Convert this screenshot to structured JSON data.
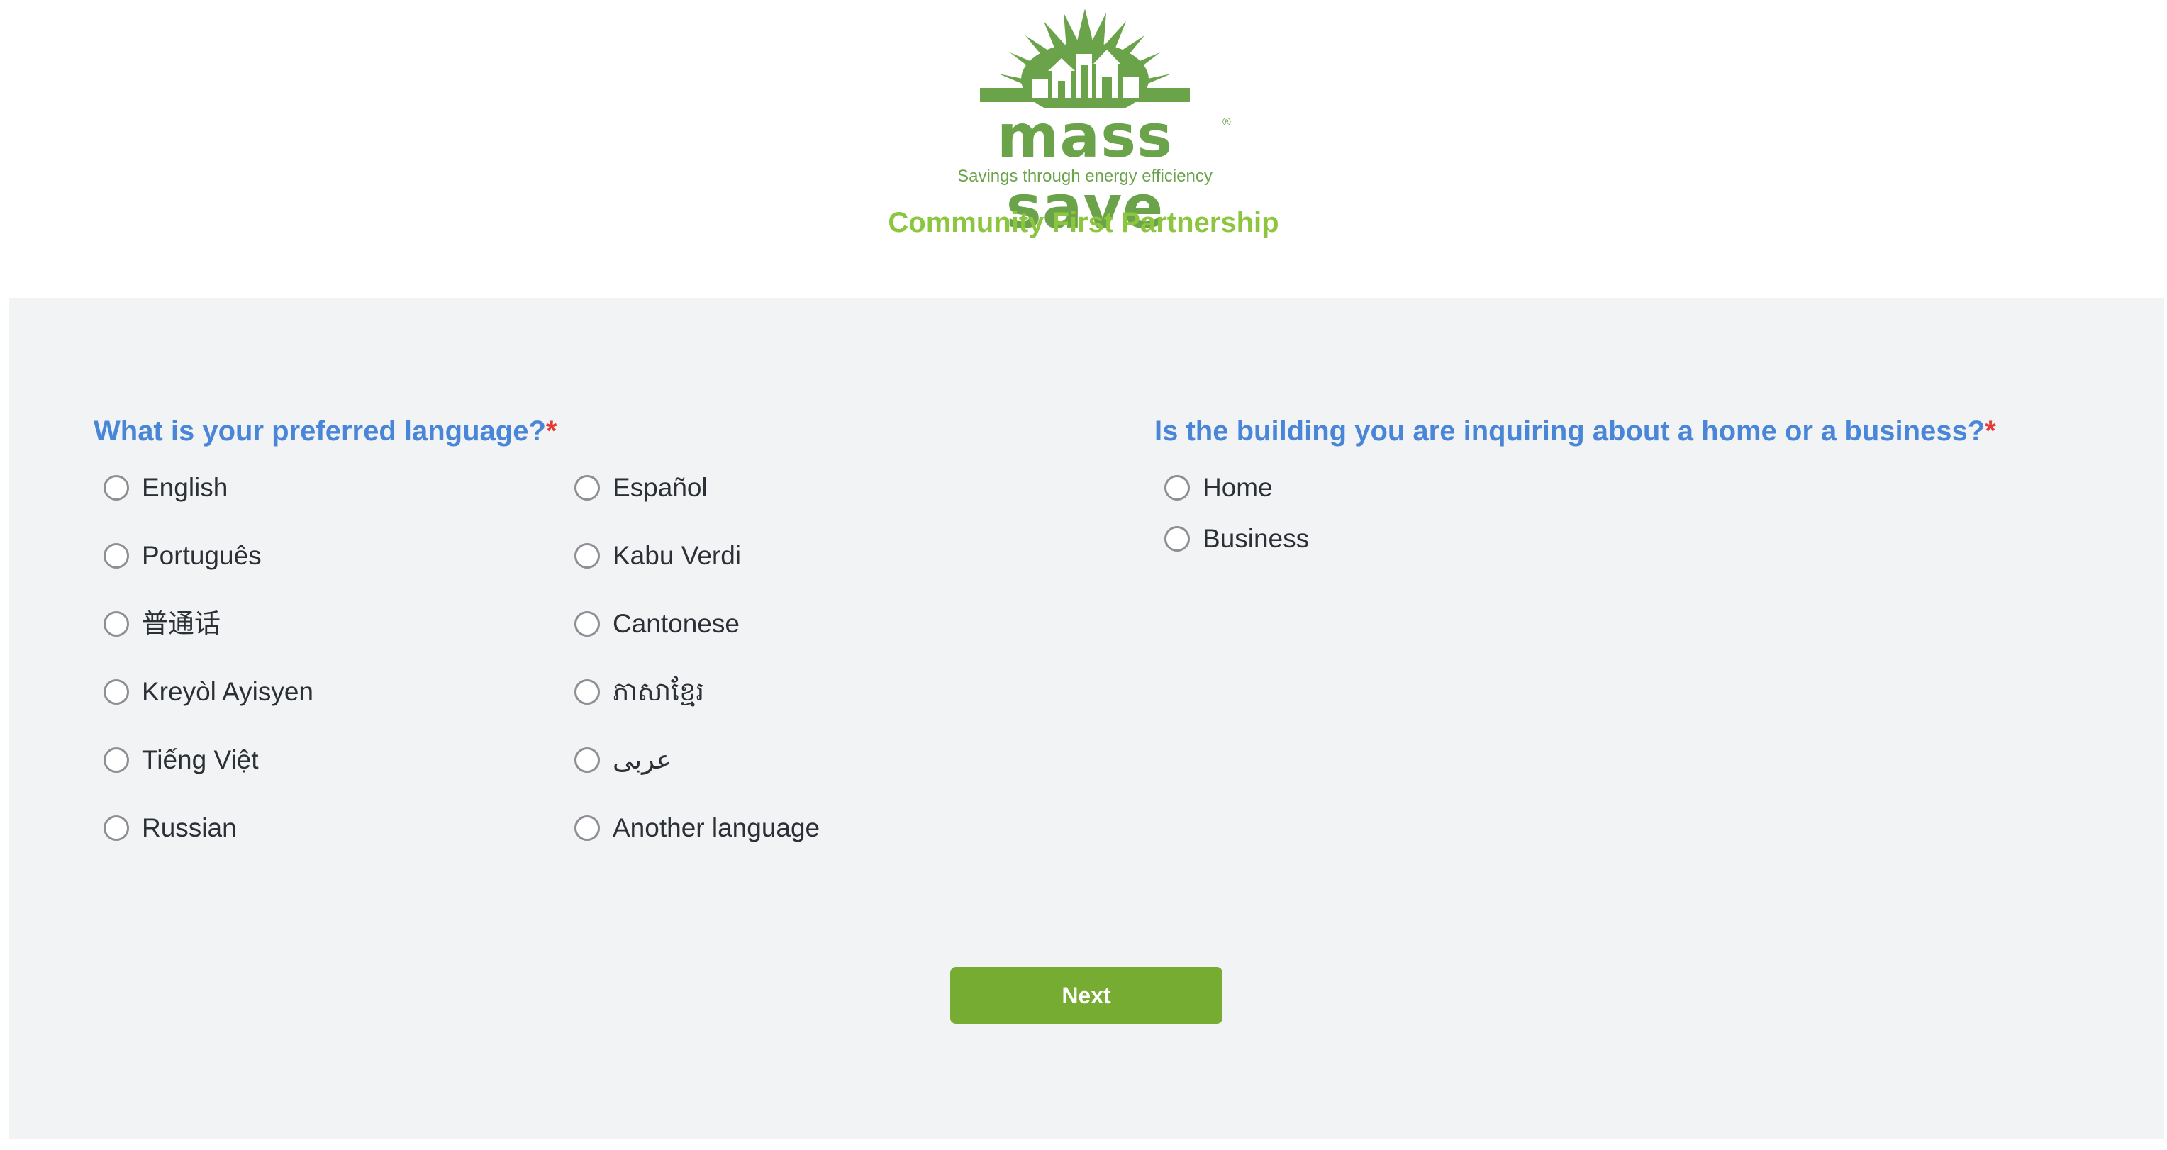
{
  "header": {
    "logo_wordmark": "mass save",
    "logo_registered": "®",
    "logo_tagline": "Savings through energy efficiency",
    "program_title": "Community First Partnership"
  },
  "language_question": {
    "title": "What is your preferred language?",
    "required_marker": "*",
    "options": [
      {
        "label": "English"
      },
      {
        "label": "Español"
      },
      {
        "label": "Português"
      },
      {
        "label": "Kabu Verdi"
      },
      {
        "label": "普通话"
      },
      {
        "label": "Cantonese"
      },
      {
        "label": "Kreyòl Ayisyen"
      },
      {
        "label": "ភាសាខ្មែរ"
      },
      {
        "label": "Tiếng Việt"
      },
      {
        "label": "عربى"
      },
      {
        "label": "Russian"
      },
      {
        "label": "Another language"
      }
    ]
  },
  "building_question": {
    "title": "Is the building you are inquiring about a home or a business?",
    "required_marker": "*",
    "options": [
      {
        "label": "Home"
      },
      {
        "label": "Business"
      }
    ]
  },
  "actions": {
    "next_label": "Next"
  },
  "colors": {
    "brand_green": "#6ba34a",
    "title_green": "#8cc63f",
    "question_blue": "#4a86d8",
    "required_red": "#e53935",
    "button_green": "#77ac33",
    "panel_bg": "#f2f3f5"
  },
  "icons": {
    "logo": "sunburst-houses-logo",
    "radio": "radio-button-unchecked-icon"
  }
}
